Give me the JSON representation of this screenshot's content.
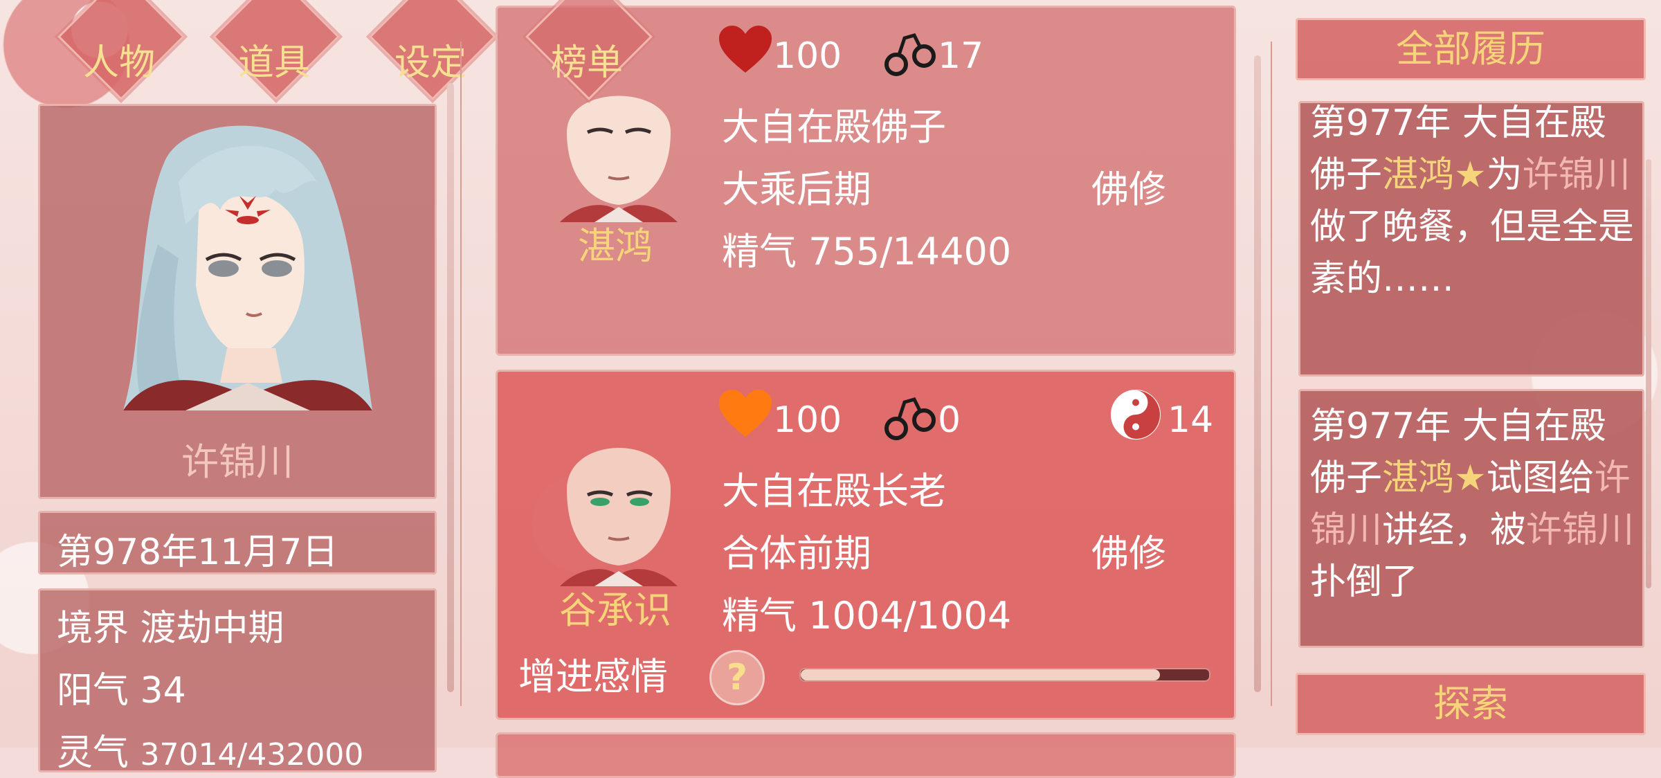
{
  "menu": {
    "tabs": [
      {
        "label": "人物"
      },
      {
        "label": "道具"
      },
      {
        "label": "设定"
      },
      {
        "label": "榜单"
      }
    ]
  },
  "player": {
    "name": "许锦川",
    "date": "第978年11月7日",
    "realm_label": "境界",
    "realm_value": "渡劫中期",
    "yang_label": "阳气",
    "yang_value": "34",
    "spirit_label": "灵气",
    "spirit_value": "37014/432000"
  },
  "characters": [
    {
      "name": "湛鸿",
      "affection": "100",
      "bond": "17",
      "title": "大自在殿佛子",
      "realm": "大乘后期",
      "path": "佛修",
      "essence_label": "精气",
      "essence_value": "755/14400",
      "heart_color": "#c0201e"
    },
    {
      "name": "谷承识",
      "affection": "100",
      "bond": "0",
      "dao": "14",
      "title": "大自在殿长老",
      "realm": "合体前期",
      "path": "佛修",
      "essence_label": "精气",
      "essence_value": "1004/1004",
      "heart_color": "#ff7a10",
      "action_label": "增进感情",
      "help_label": "?",
      "progress": 0.88
    }
  ],
  "right": {
    "history_button": "全部履历",
    "explore_button": "探索",
    "logs": [
      {
        "p1": "第977年 大自在殿佛子",
        "name1": "湛鸿",
        "star": "★",
        "p2": "为",
        "name2": "许锦川",
        "p3": "做了晚餐，但是全是素的……"
      },
      {
        "p1": "第977年 大自在殿佛子",
        "name1": "湛鸿",
        "star": "★",
        "p2": "试图给",
        "name2": "许锦川",
        "p3": "讲经，被",
        "name3": "许锦川",
        "p4": "扑倒了"
      }
    ]
  }
}
